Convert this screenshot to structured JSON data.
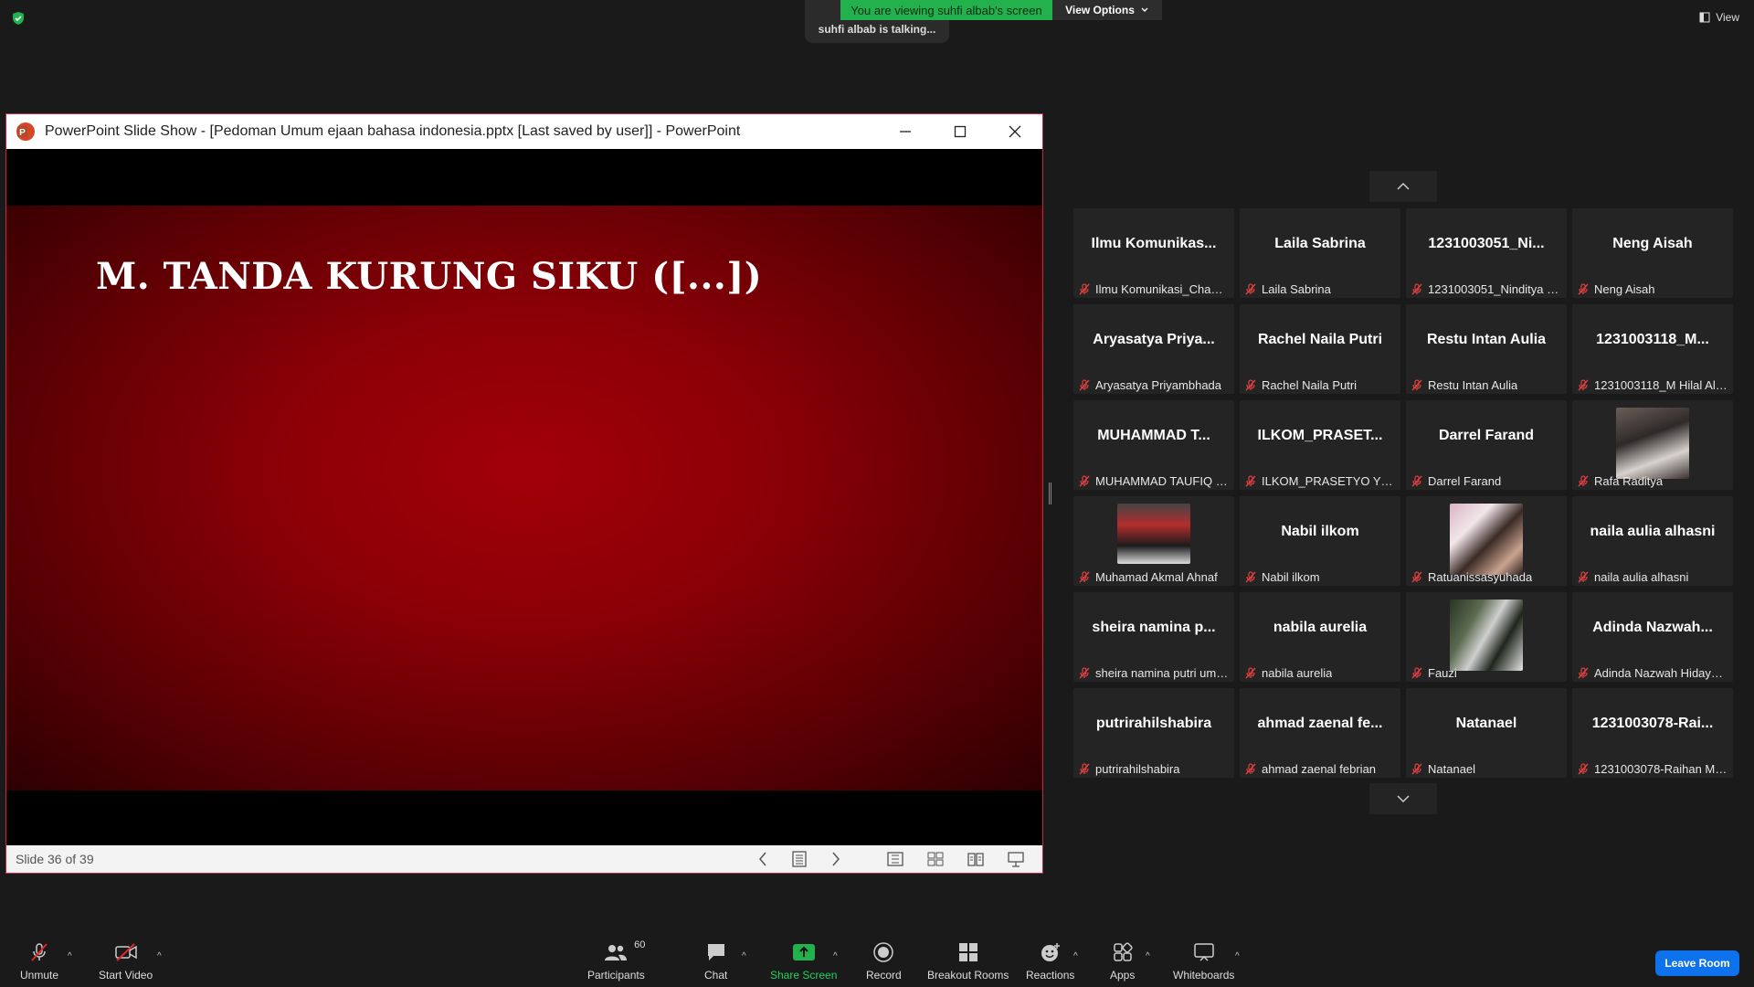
{
  "top": {
    "talking_text": "suhfi albab is talking...",
    "viewing_text": "You are viewing suhfi albab's screen",
    "view_options_label": "View Options",
    "view_label": "View"
  },
  "ppt": {
    "window_title": "PowerPoint Slide Show - [Pedoman Umum ejaan bahasa indonesia.pptx [Last saved by user]] - PowerPoint",
    "slide_title": "M. TANDA KURUNG SIKU ([...])",
    "slide_counter": "Slide 36 of 39"
  },
  "participants": [
    {
      "display": "Ilmu Komunikas...",
      "label": "Ilmu Komunikasi_Chantika",
      "video": ""
    },
    {
      "display": "Laila Sabrina",
      "label": "Laila Sabrina",
      "video": ""
    },
    {
      "display": "1231003051_Ni...",
      "label": "1231003051_Ninditya Pri...",
      "video": ""
    },
    {
      "display": "Neng Aisah",
      "label": "Neng Aisah",
      "video": ""
    },
    {
      "display": "Aryasatya Priya...",
      "label": "Aryasatya Priyambhada",
      "video": ""
    },
    {
      "display": "Rachel Naila Putri",
      "label": "Rachel Naila Putri",
      "video": ""
    },
    {
      "display": "Restu Intan Aulia",
      "label": "Restu Intan Aulia",
      "video": ""
    },
    {
      "display": "1231003118_M...",
      "label": "1231003118_M Hilal Al ...",
      "video": ""
    },
    {
      "display": "MUHAMMAD T...",
      "label": "MUHAMMAD TAUFIQ K...",
      "video": ""
    },
    {
      "display": "ILKOM_PRASET...",
      "label": "ILKOM_PRASETYO YUGO...",
      "video": ""
    },
    {
      "display": "Darrel Farand",
      "label": "Darrel Farand",
      "video": ""
    },
    {
      "display": "",
      "label": "Rafa Raditya",
      "video": "v1"
    },
    {
      "display": "",
      "label": "Muhamad Akmal Ahnaf",
      "video": "v2"
    },
    {
      "display": "Nabil ilkom",
      "label": "Nabil ilkom",
      "video": ""
    },
    {
      "display": "",
      "label": "Ratuanissasyuhada",
      "video": "v3"
    },
    {
      "display": "naila aulia alhasni",
      "label": "naila aulia alhasni",
      "video": ""
    },
    {
      "display": "sheira namina p...",
      "label": "sheira namina putri umb...",
      "video": ""
    },
    {
      "display": "nabila aurelia",
      "label": "nabila aurelia",
      "video": ""
    },
    {
      "display": "",
      "label": "Fauzi",
      "video": "v4"
    },
    {
      "display": "Adinda Nazwah...",
      "label": "Adinda Nazwah Hidayat...",
      "video": ""
    },
    {
      "display": "putrirahilshabira",
      "label": "putrirahilshabira",
      "video": ""
    },
    {
      "display": "ahmad zaenal fe...",
      "label": "ahmad zaenal febrian",
      "video": ""
    },
    {
      "display": "Natanael",
      "label": "Natanael",
      "video": ""
    },
    {
      "display": "1231003078-Rai...",
      "label": "1231003078-Raihan Mu...",
      "video": ""
    }
  ],
  "toolbar": {
    "unmute": "Unmute",
    "start_video": "Start Video",
    "participants": "Participants",
    "participants_count": "60",
    "chat": "Chat",
    "share_screen": "Share Screen",
    "record": "Record",
    "breakout_rooms": "Breakout Rooms",
    "reactions": "Reactions",
    "apps": "Apps",
    "whiteboards": "Whiteboards",
    "leave": "Leave Room"
  }
}
